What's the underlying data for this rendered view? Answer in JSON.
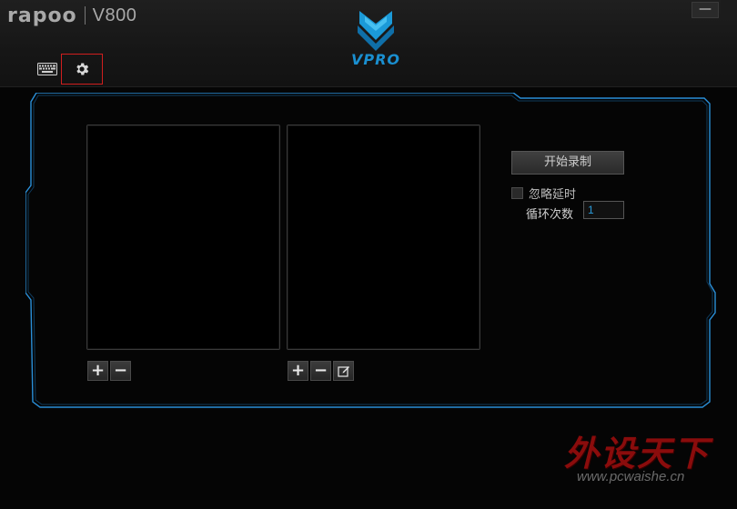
{
  "window": {
    "brand": "rapoo",
    "model": "V800",
    "minimize_label": "—"
  },
  "logo": {
    "text": "VPRO"
  },
  "tabs": [
    {
      "name": "keyboard",
      "icon": "keyboard-icon"
    },
    {
      "name": "settings",
      "icon": "gear-icon",
      "highlighted": true
    }
  ],
  "macro_editor": {
    "macro_list_buttons": {
      "add": "+",
      "remove": "−"
    },
    "action_list_buttons": {
      "add": "+",
      "remove": "−",
      "edit_icon": "edit-icon"
    },
    "record_button": "开始录制",
    "ignore_delay_label": "忽略延时",
    "ignore_delay_checked": false,
    "loop_count_label": "循环次数",
    "loop_count_value": "1"
  },
  "watermark": {
    "title": "外设天下",
    "url": "www.pcwaishe.cn"
  },
  "colors": {
    "accent_blue": "#1a8fd0",
    "frame_blue": "#2a8fd8",
    "highlight_red": "#d01e1e",
    "watermark_red": "#8a0c0c"
  }
}
